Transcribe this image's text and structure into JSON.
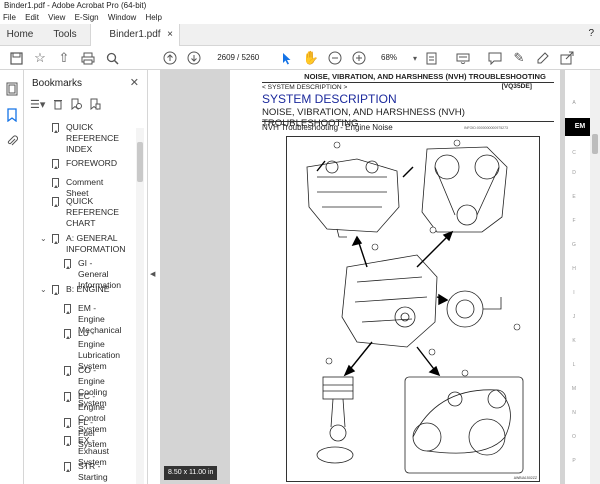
{
  "window": {
    "title": "Binder1.pdf - Adobe Acrobat Pro (64-bit)",
    "menu": [
      "File",
      "Edit",
      "View",
      "E-Sign",
      "Window",
      "Help"
    ]
  },
  "tabs": {
    "home": "Home",
    "tools": "Tools",
    "document": "Binder1.pdf",
    "close": "×"
  },
  "toolbar": {
    "current_page": "2609",
    "total_pages": "/ 5260",
    "zoom": "68%"
  },
  "bookmarks": {
    "title": "Bookmarks",
    "items": [
      {
        "label": "QUICK\nREFERENCE\nINDEX"
      },
      {
        "label": "FOREWORD"
      },
      {
        "label": "Comment Sheet"
      },
      {
        "label": "QUICK\nREFERENCE\nCHART"
      },
      {
        "label": "A: GENERAL\nINFORMATION"
      },
      {
        "label": "GI - General\nInformation"
      },
      {
        "label": "B: ENGINE"
      },
      {
        "label": "EM - Engine\nMechanical"
      },
      {
        "label": "LU - Engine\nLubrication\nSystem"
      },
      {
        "label": "CO - Engine\nCooling System"
      },
      {
        "label": "EC - Engine\nControl System"
      },
      {
        "label": "FL - Fuel System"
      },
      {
        "label": "EX - Exhaust\nSystem"
      },
      {
        "label": "STR - Starting\nSystem"
      }
    ]
  },
  "page": {
    "header": "NOISE, VIBRATION, AND HARSHNESS (NVH) TROUBLESHOOTING",
    "breadcrumb": "< SYSTEM DESCRIPTION >",
    "code": "[VQ35DE]",
    "title": "SYSTEM DESCRIPTION",
    "subtitle": "NOISE, VIBRATION, AND HARSHNESS (NVH) TROUBLESHOOTING",
    "section": "NVH Troubleshooting - Engine Noise",
    "ref": "INFOID:0000000000975273",
    "figure_code": "AWBIA1502ZZ"
  },
  "side_index": {
    "letters": [
      "A",
      "EM",
      "C",
      "D",
      "E",
      "F",
      "G",
      "H",
      "I",
      "J",
      "K",
      "L",
      "M",
      "N",
      "O",
      "P"
    ],
    "active": "EM"
  },
  "status": {
    "page_size": "8.50 x 11.00 in"
  }
}
